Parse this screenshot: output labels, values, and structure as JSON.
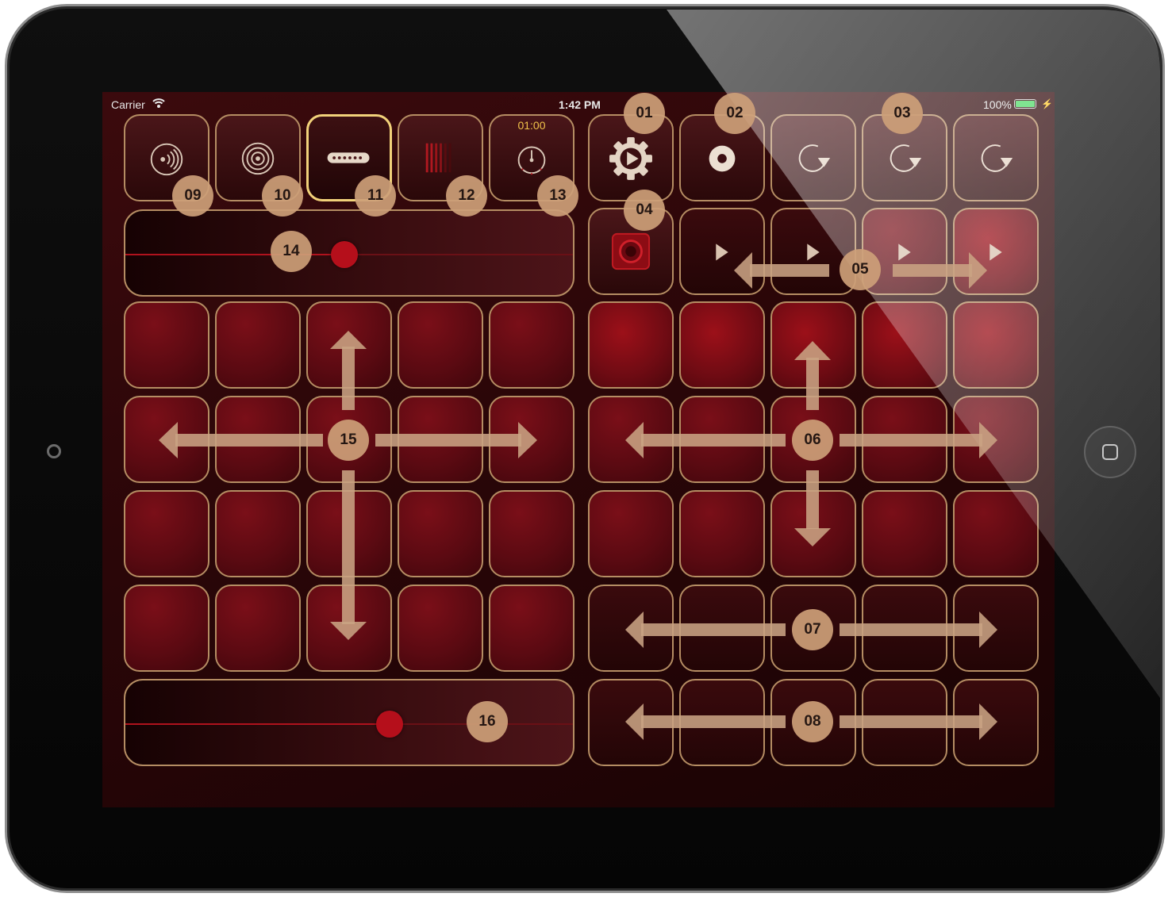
{
  "status_bar": {
    "carrier": "Carrier",
    "time": "1:42 PM",
    "battery": "100%"
  },
  "controls": {
    "timer_label": "01:00",
    "slider_top_level": 0.49,
    "slider_bottom_level": 0.59
  },
  "badges": {
    "b01": "01",
    "b02": "02",
    "b03": "03",
    "b04": "04",
    "b05": "05",
    "b06": "06",
    "b07": "07",
    "b08": "08",
    "b09": "09",
    "b10": "10",
    "b11": "11",
    "b12": "12",
    "b13": "13",
    "b14": "14",
    "b15": "15",
    "b16": "16"
  },
  "icons": {
    "c1": "speaker-waves-icon",
    "c2": "concentric-rings-icon",
    "c3": "pickup-bar-icon",
    "c4": "vertical-bars-icon",
    "c5": "metronome-dial-icon",
    "r1": "gear-play-icon",
    "r2": "record-dot-icon",
    "r3": "loop-arrow-icon",
    "r4": "loop-arrow-icon",
    "r5": "loop-arrow-icon",
    "rec": "record-button-icon",
    "play": "play-triangle-icon"
  },
  "colors": {
    "accent": "#b58d63",
    "selected": "#f2d27a",
    "pad": "#6e0b13",
    "knob": "#b50f1b",
    "badge": "#cda078"
  }
}
